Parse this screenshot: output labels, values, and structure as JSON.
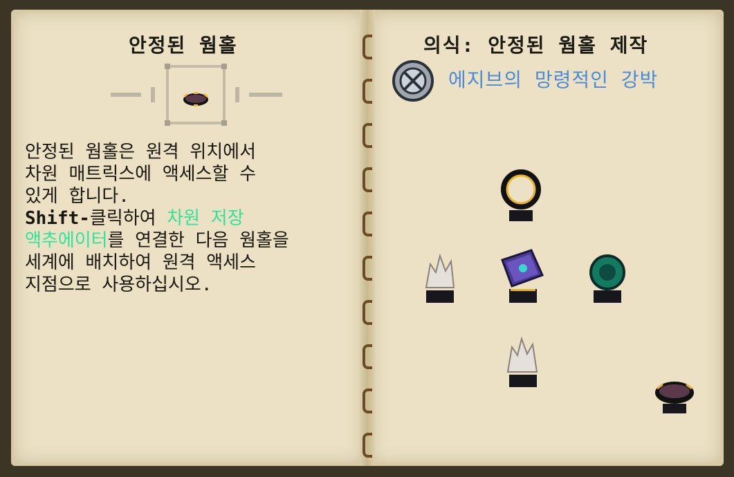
{
  "left_page": {
    "title": "안정된 웜홀",
    "body_line1": "안정된 웜홀은 원격 위치에서",
    "body_line2": "차원 매트릭스에 액세스할 수",
    "body_line3": "있게 합니다.",
    "shift": "Shift-",
    "click_text": "클릭하여 ",
    "link1": "차원 저장",
    "link2": "액추에이터",
    "body_line5_rest": "를 연결한 다음 웜홀을",
    "body_line6": "세계에 배치하여 원격 액세스",
    "body_line7": "지점으로 사용하십시오."
  },
  "right_page": {
    "title": "의식: 안정된 웜홀 제작",
    "research": "에지브의 망령적인 강박"
  },
  "colors": {
    "page": "#ece1c4",
    "text": "#18160f",
    "link": "#2fe39a",
    "research": "#4a8bd6"
  },
  "icons": [
    "wormhole-item-icon",
    "research-medallion-icon",
    "gold-ring-icon",
    "quartz-crystal-icon",
    "arcane-book-icon",
    "ender-pearl-icon",
    "stable-wormhole-icon"
  ]
}
